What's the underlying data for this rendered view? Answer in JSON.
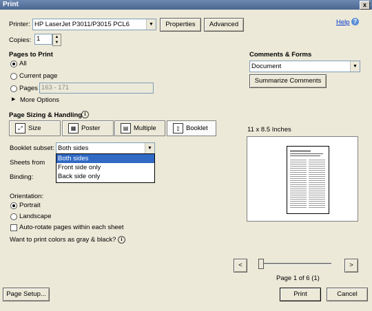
{
  "window": {
    "title": "Print",
    "close_glyph": "x"
  },
  "printer": {
    "label": "Printer:",
    "value": "HP LaserJet P3011/P3015 PCL6",
    "properties": "Properties",
    "advanced": "Advanced"
  },
  "help": {
    "label": "Help",
    "icon": "help-icon"
  },
  "copies": {
    "label": "Copies:",
    "value": "1"
  },
  "pages_to_print": {
    "heading": "Pages to Print",
    "all": "All",
    "current": "Current page",
    "pages": "Pages",
    "pages_value": "163 - 171",
    "more": "More Options"
  },
  "comments": {
    "heading": "Comments & Forms",
    "value": "Document",
    "summarize": "Summarize Comments"
  },
  "sizing": {
    "heading": "Page Sizing & Handling",
    "tabs": [
      "Size",
      "Poster",
      "Multiple",
      "Booklet"
    ],
    "selected_tab": "Booklet"
  },
  "booklet": {
    "subset_label": "Booklet subset:",
    "subset_value": "Both sides",
    "options": [
      "Both sides",
      "Front side only",
      "Back side only"
    ],
    "sheets_label": "Sheets from",
    "binding_label": "Binding:"
  },
  "orientation": {
    "heading": "Orientation:",
    "portrait": "Portrait",
    "landscape": "Landscape",
    "autorotate": "Auto-rotate pages within each sheet"
  },
  "gray": {
    "label": "Want to print colors as gray & black?"
  },
  "preview": {
    "size": "11 x 8.5 Inches",
    "page_info": "Page 1 of 6 (1)",
    "prev": "<",
    "next": ">",
    "position": 0
  },
  "footer": {
    "page_setup": "Page Setup...",
    "print": "Print",
    "cancel": "Cancel"
  }
}
